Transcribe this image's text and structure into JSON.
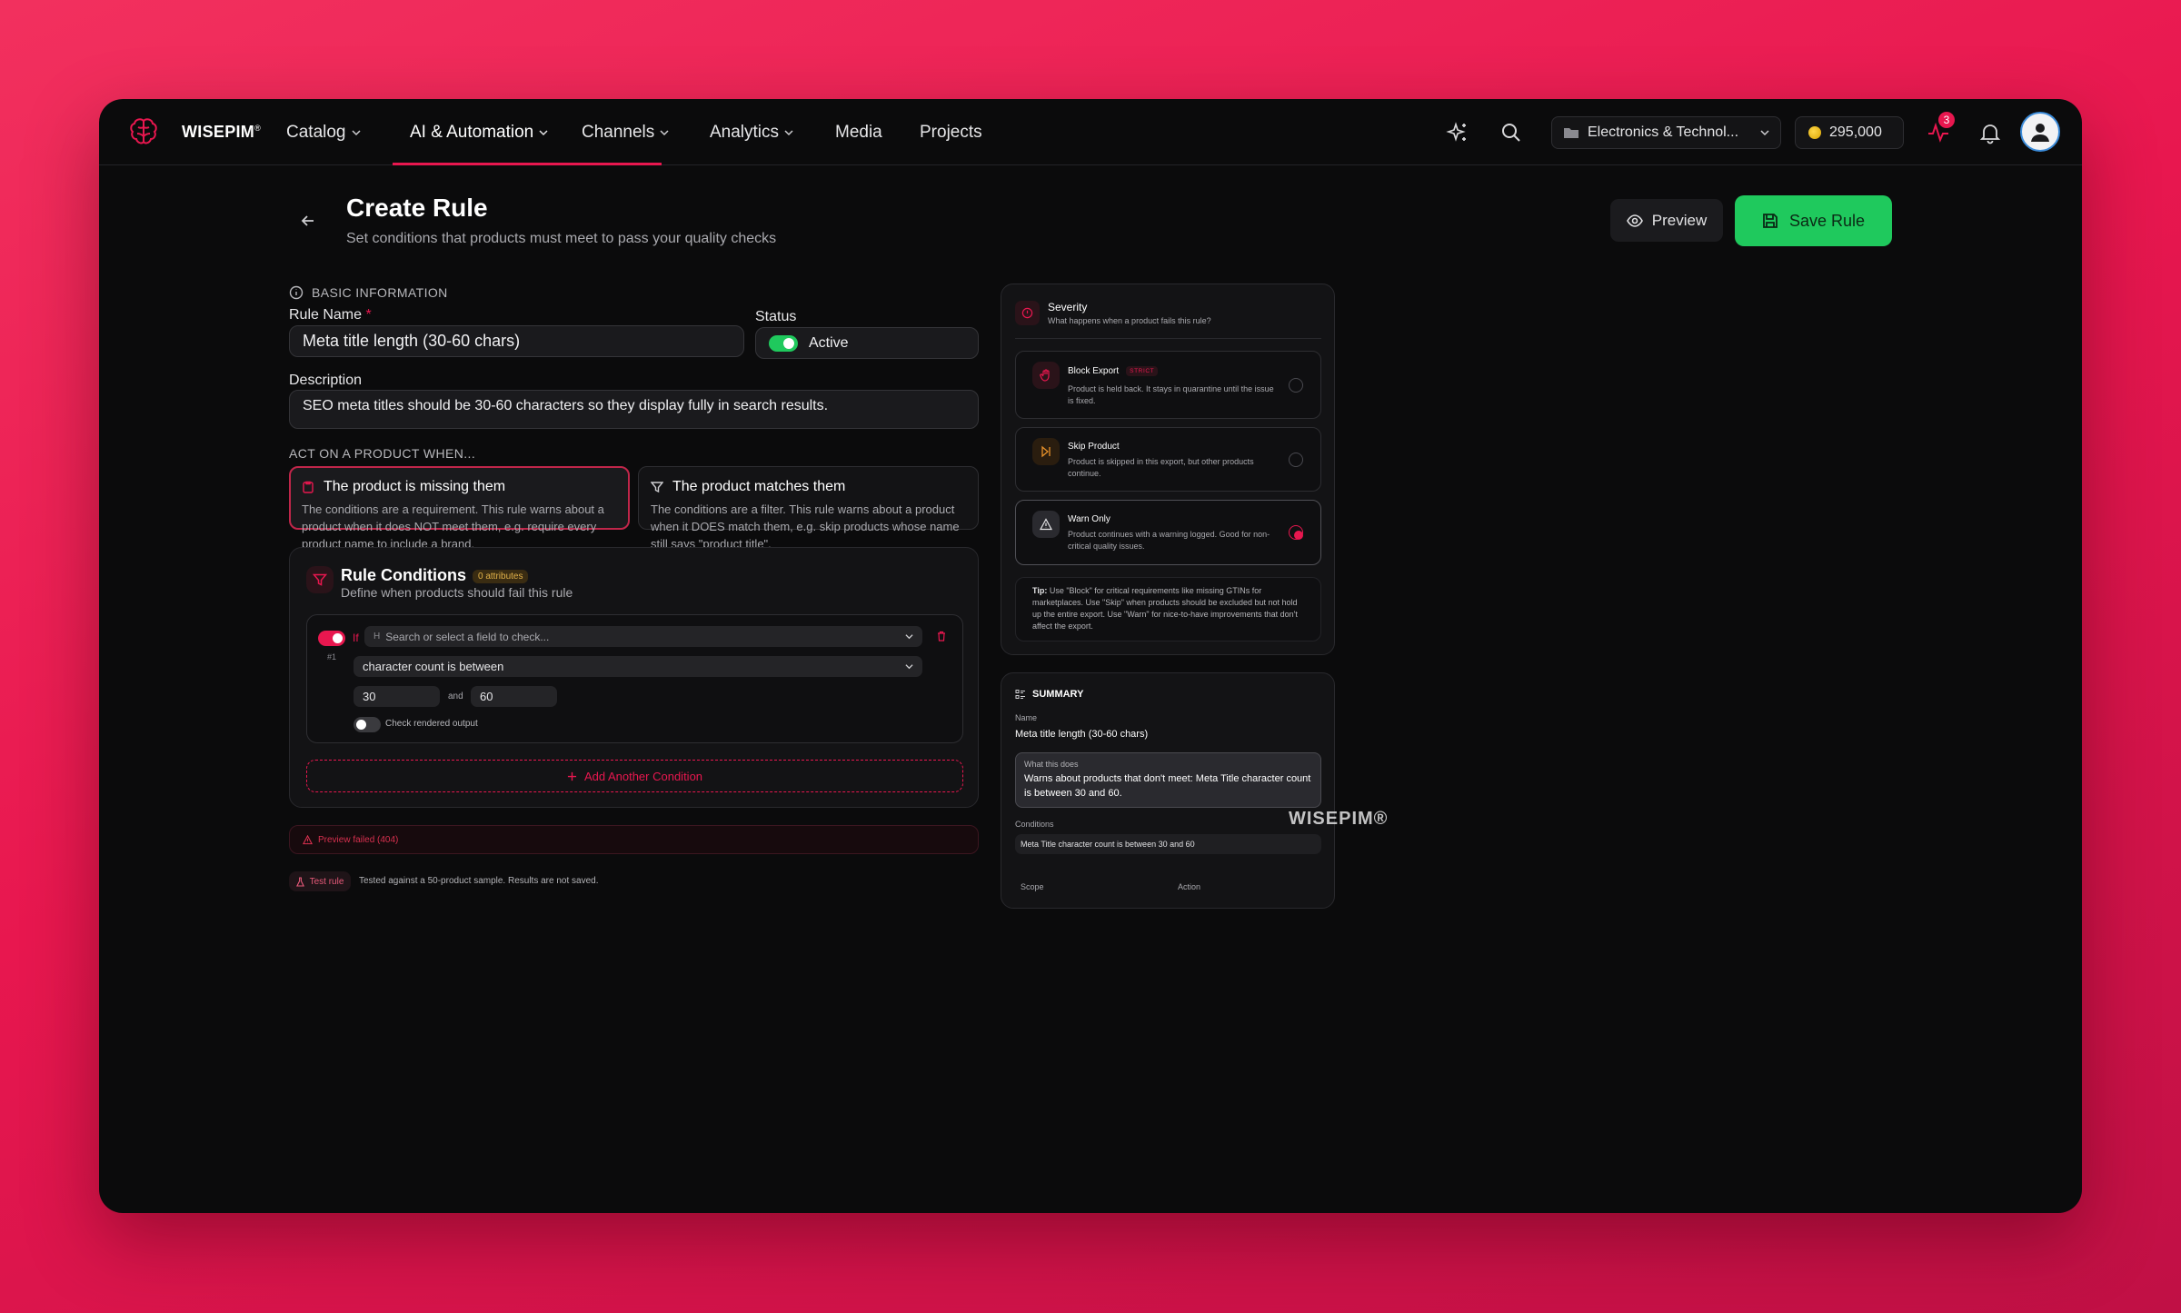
{
  "nav": {
    "brand": "WISEPIM",
    "brand_mark": "®",
    "items": [
      {
        "label": "Catalog",
        "dropdown": true
      },
      {
        "label": "AI & Automation",
        "dropdown": true,
        "active": true
      },
      {
        "label": "Channels",
        "dropdown": true
      },
      {
        "label": "Analytics",
        "dropdown": true
      },
      {
        "label": "Media",
        "dropdown": false
      },
      {
        "label": "Projects",
        "dropdown": false
      }
    ],
    "catalog_selector": "Electronics & Technol...",
    "credits": "295,000",
    "activity_badge": "3",
    "icons": [
      "sparkles-icon",
      "search-icon",
      "folder-icon",
      "activity-icon",
      "bell-icon",
      "user-icon"
    ]
  },
  "header": {
    "title": "Create Rule",
    "subtitle": "Set conditions that products must meet to pass your quality checks",
    "preview_label": "Preview",
    "save_label": "Save Rule"
  },
  "basic": {
    "section_label": "BASIC INFORMATION",
    "rule_name_label": "Rule Name",
    "required_mark": "*",
    "rule_name_value": "Meta title length (30-60 chars)",
    "status_label": "Status",
    "status_value": "Active",
    "status_on": true,
    "description_label": "Description",
    "description_value": "SEO meta titles should be 30-60 characters so they display fully in search results."
  },
  "act_on": {
    "section_label": "ACT ON A PRODUCT WHEN...",
    "options": [
      {
        "title": "The product is missing them",
        "description": "The conditions are a requirement. This rule warns about a product when it does NOT meet them, e.g. require every product name to include a brand.",
        "selected": true
      },
      {
        "title": "The product matches them",
        "description": "The conditions are a filter. This rule warns about a product when it DOES match them, e.g. skip products whose name still says \"product title\".",
        "selected": false
      }
    ]
  },
  "conditions": {
    "title": "Rule Conditions",
    "attr_badge": "0 attributes",
    "subtitle": "Define when products should fail this rule",
    "if_label": "If",
    "index_label": "#1",
    "field_placeholder": "Search or select a field to check...",
    "operator_value": "character count is between",
    "min_value": "30",
    "and_label": "and",
    "max_value": "60",
    "rendered_label": "Check rendered output",
    "add_label": "Add Another Condition"
  },
  "preview": {
    "error": "Preview failed (404)",
    "test_label": "Test rule",
    "test_note": "Tested against a 50-product sample. Results are not saved."
  },
  "severity": {
    "title": "Severity",
    "subtitle": "What happens when a product fails this rule?",
    "options": [
      {
        "title": "Block Export",
        "tag": "STRICT",
        "description": "Product is held back. It stays in quarantine until the issue is fixed.",
        "selected": false
      },
      {
        "title": "Skip Product",
        "tag": "",
        "description": "Product is skipped in this export, but other products continue.",
        "selected": false
      },
      {
        "title": "Warn Only",
        "tag": "",
        "description": "Product continues with a warning logged. Good for non-critical quality issues.",
        "selected": true
      }
    ],
    "tip_label": "Tip:",
    "tip_text": "Use \"Block\" for critical requirements like missing GTINs for marketplaces. Use \"Skip\" when products should be excluded but not hold up the entire export. Use \"Warn\" for nice-to-have improvements that don't affect the export."
  },
  "summary": {
    "title": "SUMMARY",
    "name_label": "Name",
    "name_value": "Meta title length (30-60 chars)",
    "what_label": "What this does",
    "what_value": "Warns about products that don't meet: Meta Title character count is between 30 and 60.",
    "conditions_label": "Conditions",
    "conditions_value": "Meta Title character count is between 30 and 60",
    "scope_label": "Scope",
    "action_label": "Action"
  },
  "watermark": "WISEPIM®",
  "colors": {
    "accent": "#e8174f",
    "success": "#1fc95d",
    "warning": "#e2b24a",
    "skip": "#e8912a"
  }
}
